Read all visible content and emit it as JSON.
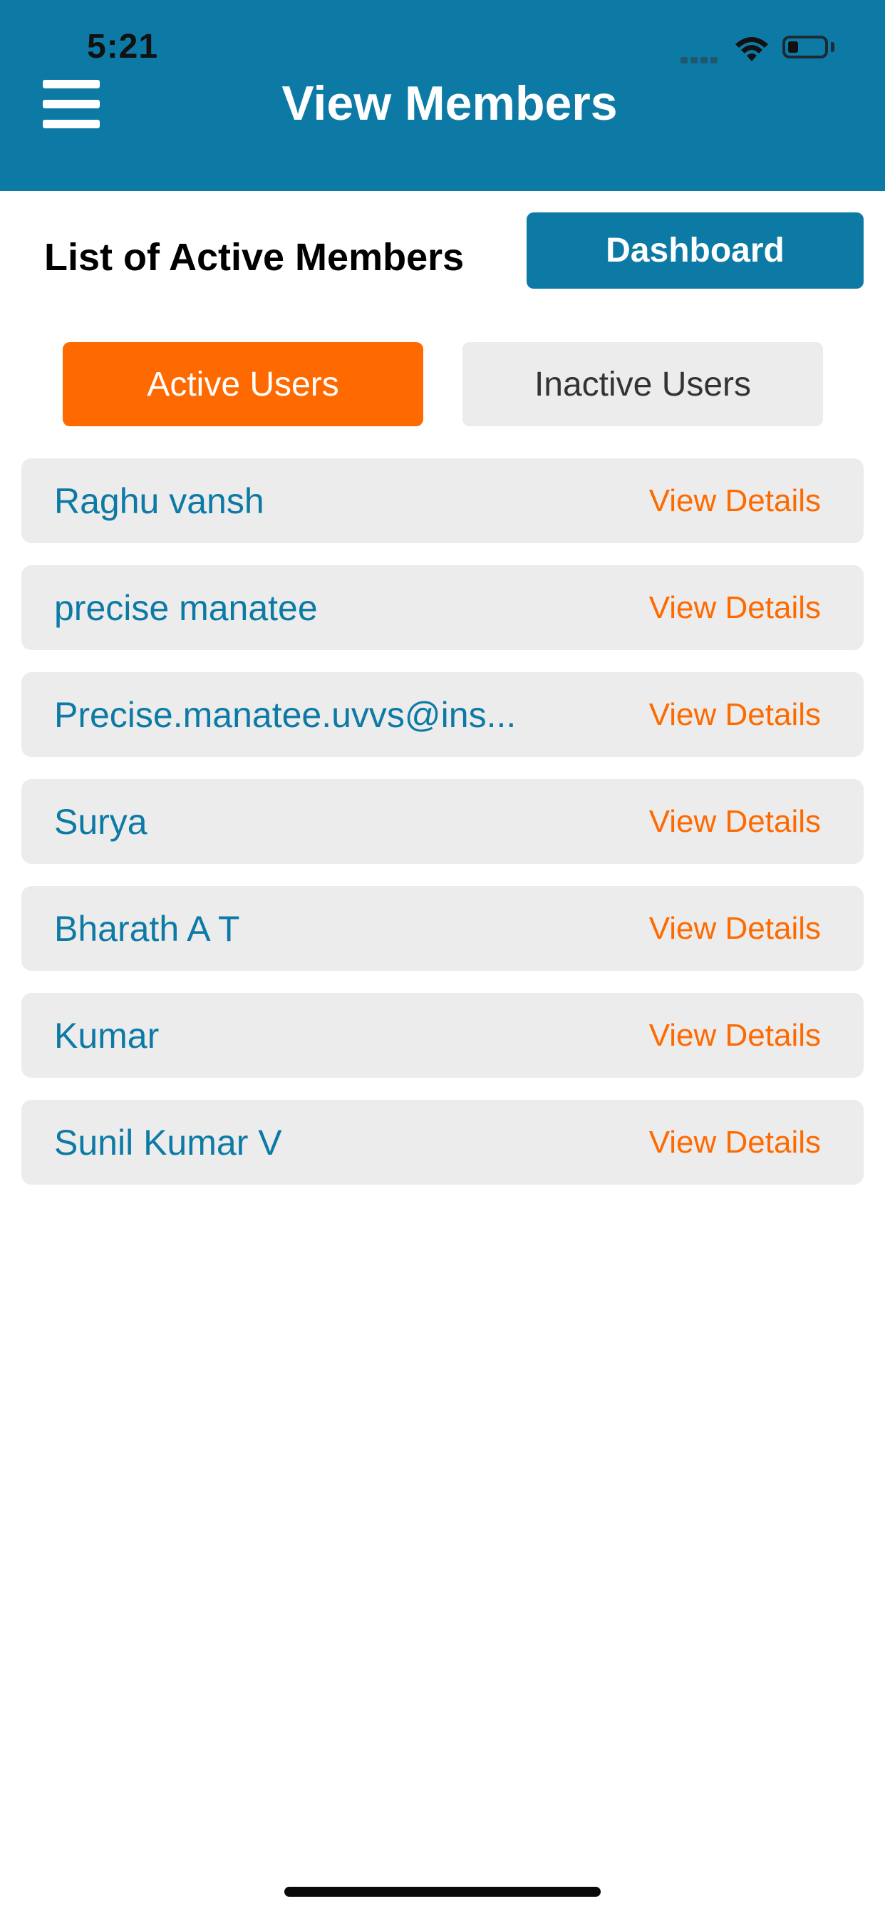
{
  "status_bar": {
    "time": "5:21"
  },
  "header": {
    "title": "View Members"
  },
  "section": {
    "title": "List of Active Members",
    "dashboard_label": "Dashboard"
  },
  "tabs": {
    "active": "Active Users",
    "inactive": "Inactive Users"
  },
  "members": [
    {
      "name": "Raghu vansh",
      "action": "View Details"
    },
    {
      "name": "precise manatee",
      "action": "View Details"
    },
    {
      "name": "Precise.manatee.uvvs@ins...",
      "action": "View Details"
    },
    {
      "name": "Surya",
      "action": "View Details"
    },
    {
      "name": "Bharath A T",
      "action": "View Details"
    },
    {
      "name": "Kumar",
      "action": "View Details"
    },
    {
      "name": "Sunil Kumar V",
      "action": "View Details"
    }
  ],
  "colors": {
    "primary": "#0d7aa6",
    "accent": "#ff6a00",
    "row_bg": "#ececec"
  },
  "icons": {
    "menu": "hamburger-menu-icon",
    "wifi": "wifi-icon",
    "battery": "battery-icon",
    "signal": "signal-icon"
  }
}
